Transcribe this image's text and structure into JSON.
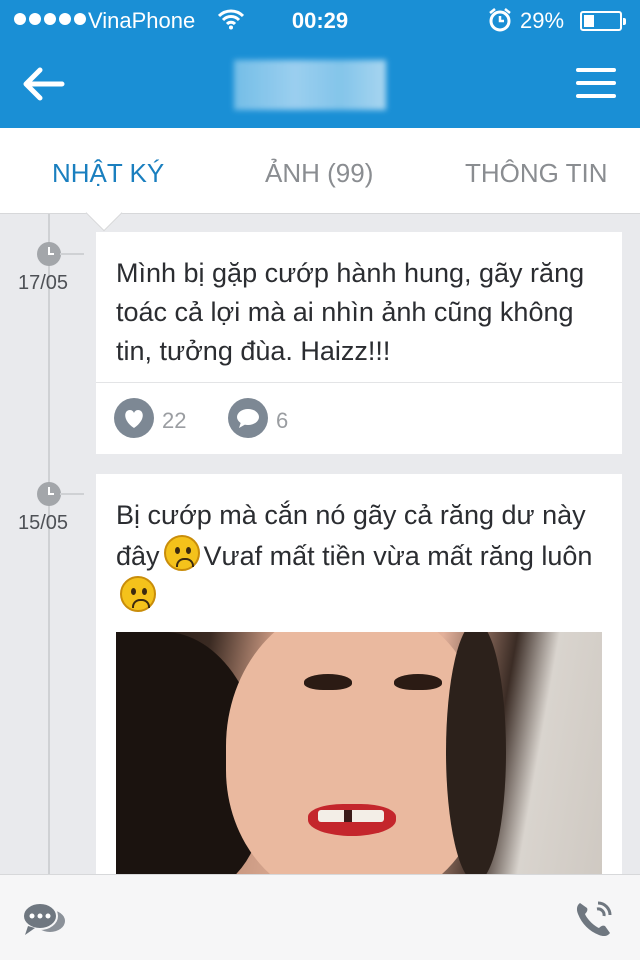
{
  "status_bar": {
    "carrier": "VinaPhone",
    "time": "00:29",
    "battery": "29%",
    "battery_level": 0.29
  },
  "tabs": [
    {
      "label": "NHẬT KÝ",
      "active": true
    },
    {
      "label": "ẢNH (99)",
      "active": false
    },
    {
      "label": "THÔNG TIN",
      "active": false
    }
  ],
  "posts": [
    {
      "date": "17/05",
      "text": "Mình bị gặp cướp hành hung, gãy răng toác cả lợi mà ai nhìn ảnh cũng không tin, tưởng đùa.  Haizz!!!",
      "likes": "22",
      "comments": "6"
    },
    {
      "date": "15/05",
      "text_part1": "Bị cướp mà cắn nó gãy cả răng dư này đây",
      "text_part2": "Vưaf mất tiền vừa mất răng luôn",
      "emoji": "frowning-face"
    }
  ],
  "colors": {
    "header": "#1a8fd5",
    "active_tab": "#1a7fbf",
    "inactive_tab": "#8a8d91",
    "background": "#e9eaed"
  },
  "icons": {
    "back": "arrow-left-icon",
    "menu": "hamburger-menu-icon",
    "like": "heart-icon",
    "comment": "speech-bubble-icon",
    "chat": "chat-bubbles-icon",
    "call": "phone-icon"
  }
}
